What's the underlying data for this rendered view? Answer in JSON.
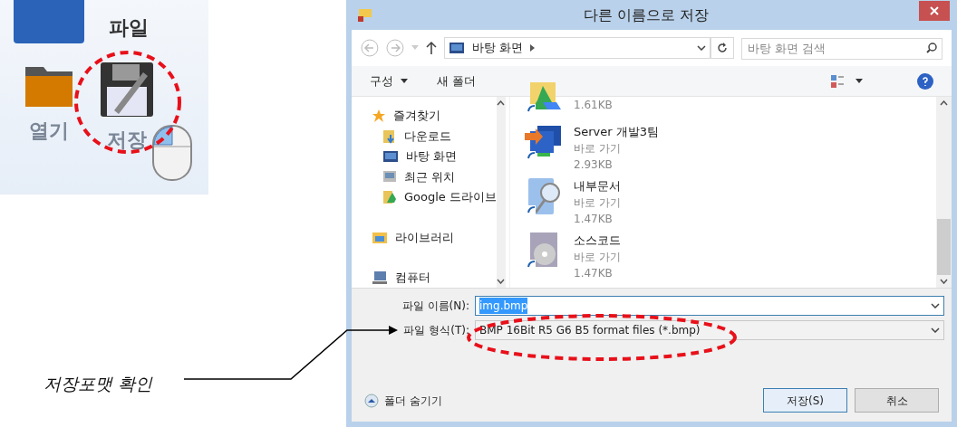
{
  "ribbon": {
    "tab": "파일",
    "buttons": [
      {
        "label": "열기",
        "kind": "folder"
      },
      {
        "label": "저장",
        "kind": "save"
      }
    ]
  },
  "annotation": {
    "text": "저장포맷 확인"
  },
  "dialog": {
    "title": "다른 이름으로 저장",
    "address": "바탕 화면",
    "search": {
      "placeholder": "바탕 화면 검색"
    },
    "toolbar": [
      "구성",
      "새 폴더"
    ],
    "nav": [
      {
        "label": "즐겨찾기",
        "kind": "star",
        "children": [
          {
            "label": "다운로드",
            "kind": "download"
          },
          {
            "label": "바탕 화면",
            "kind": "desktop"
          },
          {
            "label": "최근 위치",
            "kind": "recent"
          },
          {
            "label": "Google 드라이브",
            "kind": "drive"
          }
        ]
      },
      {
        "label": "라이브러리",
        "kind": "library"
      },
      {
        "label": "컴퓨터",
        "kind": "computer"
      }
    ],
    "files": [
      {
        "kind": "drive",
        "size": "1.61KB"
      },
      {
        "kind": "network",
        "name": "Server 개발3팀",
        "type": "바로 가기",
        "size": "2.93KB"
      },
      {
        "kind": "search",
        "name": "내부문서",
        "type": "바로 가기",
        "size": "1.47KB"
      },
      {
        "kind": "disc",
        "name": "소스코드",
        "type": "바로 가기",
        "size": "1.47KB"
      }
    ],
    "filename_label": "파일 이름(N):",
    "filename": "img.bmp",
    "filetype_label": "파일 형식(T):",
    "filetype": "BMP 16Bit R5 G6 B5 format files (*.bmp)",
    "hide_folders": "폴더 숨기기",
    "buttons": [
      "저장(S)",
      "취소"
    ]
  }
}
